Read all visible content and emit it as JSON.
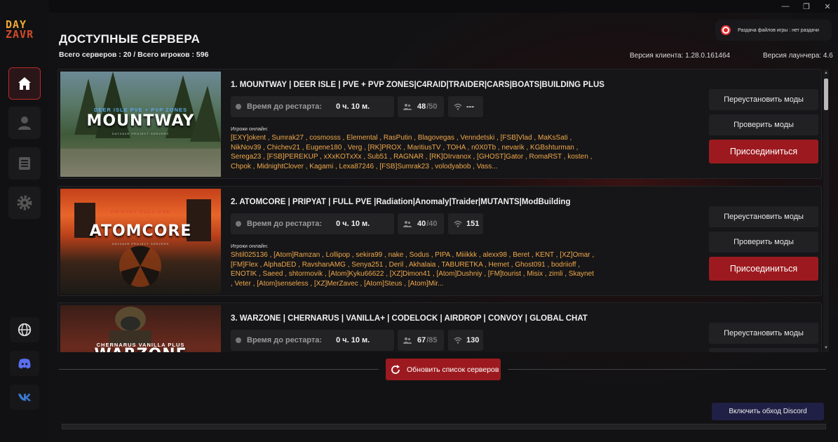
{
  "window": {
    "minimize": "—",
    "maximize": "❐",
    "close": "✕"
  },
  "logo": {
    "line1": "DAY",
    "line2": "ZAVR"
  },
  "nav": [
    "home-icon",
    "user-icon",
    "book-icon",
    "gear-icon"
  ],
  "social": [
    "globe-icon",
    "discord-icon",
    "vk-icon"
  ],
  "header": {
    "title": "ДОСТУПНЫЕ СЕРВЕРА",
    "stats": "Всего серверов : 20 / Всего игроков : 596",
    "client_version": "Версия клиента: 1.28.0.161464",
    "launcher_version": "Версия лаунчера: 4.6",
    "file_distribution": "Раздача файлов игры : нет раздачи"
  },
  "labels": {
    "restart": "Время до рестарта:",
    "players_online": "Игроки онлайн:",
    "reinstall_mods": "Переустановить моды",
    "verify_mods": "Проверить моды",
    "join": "Присоединиться",
    "refresh": "Обновить список серверов",
    "discord_bypass": "Включить обход Discord"
  },
  "servers": [
    {
      "name": "1. MOUNTWAY | DEER ISLE | PVE + PVP ZONES|C4RAID|TRAIDER|CARS|BOATS|BUILDING PLUS",
      "restart": "0 ч. 10 м.",
      "players": "48",
      "max": "/50",
      "ping": "---",
      "thumb_sub": "DEER ISLE PVE + PVP ZONES",
      "thumb_title": "MOUNTWAY",
      "thumb_tiny": "DAYZAVR PROJECT SERVERS",
      "online": "[EXY]okent , Sumrak27 , cosmosss , Elemental , RasPutin , Blagovegas , Venndetski , [FSB]Vlad , MaKsSati , NikNov39 , Chichev21 , Eugene180 , Verg , [RK]PROX , MaritiusTV , TOHA , n0X0Tb , nevarik , KGBshturman , Serega23 , [FSB]PEREKUP , xXxKOTxXx , Sub51 , RAGNAR , [RK]DIrvanox , [GHOST]Gator , RomaRST , kosten , Chpok , MidnightClover , Kagami , Lexa87246 , [FSB]Sumrak23 , volodyabob , Vass..."
    },
    {
      "name": "2. ATOMCORE | PRIPYAT | FULL PVE |Radiation|Anomaly|Traider|MUTANTS|ModBuilding",
      "restart": "0 ч. 10 м.",
      "players": "40",
      "max": "/40",
      "ping": "151",
      "thumb_sub": "PRIPYAT FULL PVE",
      "thumb_title": "ATOMCORE",
      "thumb_tiny": "DAYZAVR PROJECT SERVERS",
      "online": "Shtil025136 , [Atom]Ramzan , Lollipop , sekira99 , nake , Sodus , PIPA , Miiikkk , alexx98 , Beret , KENT , [XZ]Omar , [FM]Flex , AlphaDED , RavshanAMG , Senya251 , Deril , Akhalaia , TABURETKA , Hemet , Ghost091 , bodriioff , ENOTIK , Saeed , shtormovik , [Atom]Kyku66622 , [XZ]Dimon41 , [Atom]Dushniy , [FM]tourist , Misix , zimli , Skaynet , Veter , [Atom]senseless , [XZ]MerZavec , [Atom]Steus , [Atom]Mir..."
    },
    {
      "name": "3. WARZONE | CHERNARUS | VANILLA+ | CODELOCK | AIRDROP | CONVOY | GLOBAL CHAT",
      "restart": "0 ч. 10 м.",
      "players": "67",
      "max": "/85",
      "ping": "130",
      "thumb_sub": "CHERNARUS VANILLA PLUS",
      "thumb_title": "WARZONE",
      "thumb_tiny": "",
      "online": ""
    }
  ],
  "colors": {
    "accent": "#9c1a1f",
    "player_names": "#f0a84a"
  }
}
